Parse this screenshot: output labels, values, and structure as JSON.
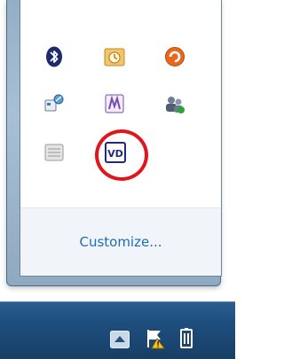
{
  "notification_area_flyout": {
    "icons": [
      {
        "name": "bluetooth-icon"
      },
      {
        "name": "outlook-reminder-icon"
      },
      {
        "name": "orange-app-icon"
      },
      {
        "name": "network-connection-icon"
      },
      {
        "name": "onenote-clipping-icon"
      },
      {
        "name": "users-icon"
      },
      {
        "name": "blank-app-icon"
      },
      {
        "name": "vd-icon",
        "label": "VD"
      }
    ],
    "customize_label": "Customize..."
  },
  "taskbar": {
    "tray_icons": [
      "show-hidden-icons-button",
      "action-center-flag-icon",
      "power-icon"
    ]
  },
  "colors": {
    "highlight": "#e0161c",
    "link": "#1a6fb0",
    "taskbar": "#1f4f7f"
  }
}
